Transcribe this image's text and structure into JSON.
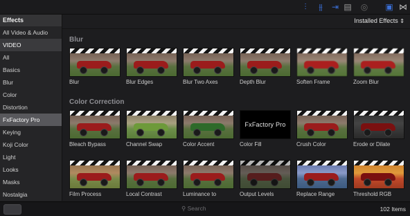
{
  "sidebar": {
    "header": "Effects",
    "items": [
      {
        "label": "All Video & Audio",
        "state": "normal"
      },
      {
        "label": "VIDEO",
        "state": "section"
      },
      {
        "label": "All",
        "state": "normal"
      },
      {
        "label": "Basics",
        "state": "normal"
      },
      {
        "label": "Blur",
        "state": "normal"
      },
      {
        "label": "Color",
        "state": "normal"
      },
      {
        "label": "Distortion",
        "state": "normal"
      },
      {
        "label": "FxFactory Pro",
        "state": "selected"
      },
      {
        "label": "Keying",
        "state": "normal"
      },
      {
        "label": "Koji Color",
        "state": "normal"
      },
      {
        "label": "Light",
        "state": "normal"
      },
      {
        "label": "Looks",
        "state": "normal"
      },
      {
        "label": "Masks",
        "state": "normal"
      },
      {
        "label": "Nostalgia",
        "state": "normal"
      }
    ]
  },
  "main": {
    "filter_label": "Installed Effects",
    "categories": [
      {
        "title": "Blur",
        "tiles": [
          "Blur",
          "Blur Edges",
          "Blur Two Axes",
          "Depth Blur",
          "Soften Frame",
          "Zoom Blur"
        ]
      },
      {
        "title": "Color Correction",
        "tiles": [
          "Bleach Bypass",
          "Channel Swap",
          "Color Accent",
          "Color Fill",
          "Crush Color",
          "Erode or Dilate",
          "Film Process",
          "Local Contrast",
          "Luminance to",
          "Output Levels",
          "Replace Range",
          "Threshold RGB"
        ]
      }
    ],
    "fx_logo_text": "FxFactory Pro"
  },
  "bottom": {
    "search_placeholder": "Search",
    "items_count": "102 Items"
  },
  "colors": {
    "accent_blue": "#3b6fd6",
    "selected_row": "#58585c"
  }
}
